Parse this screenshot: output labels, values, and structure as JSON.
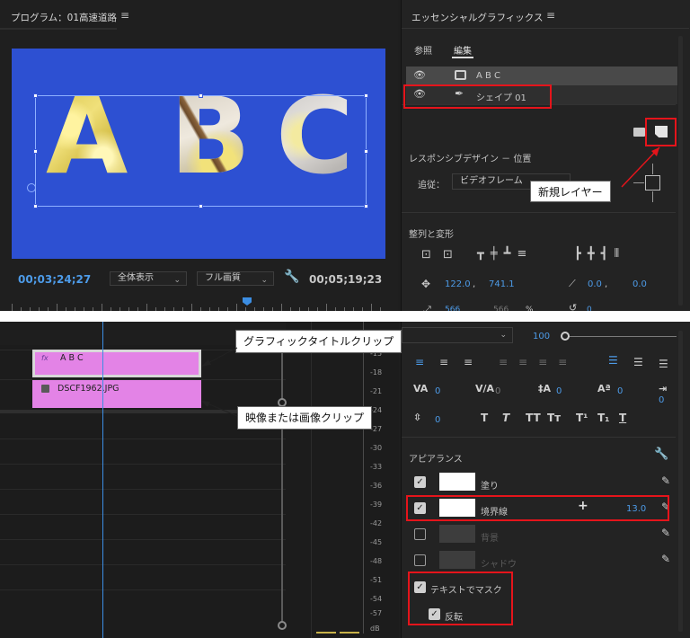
{
  "program": {
    "title": "プログラム：01高速道路",
    "letters": [
      "A",
      "B",
      "C"
    ],
    "timecode_current": "00;03;24;27",
    "zoom": "全体表示",
    "quality": "フル画質",
    "timecode_duration": "00;05;19;23"
  },
  "egfx": {
    "title": "エッセンシャルグラフィックス",
    "tab_browse": "参照",
    "tab_edit": "編集",
    "layers": [
      {
        "label": "A B C"
      },
      {
        "label": "シェイプ 01"
      }
    ],
    "responsive_title": "レスポンシブデザイン － 位置",
    "follow_label": "追従：",
    "follow_value": "ビデオフレーム",
    "align_title": "整列と変形",
    "pos_x": "122.0",
    "pos_sep": ",",
    "pos_y": "741.1",
    "anchor_x": "0.0",
    "anchor_sep": ",",
    "anchor_y": "0.0",
    "scale_w": "566",
    "scale_h": "566",
    "scale_pct": "%",
    "rotation": "0"
  },
  "callouts": {
    "new_layer": "新規レイヤー",
    "graphic_clip": "グラフィックタイトルクリップ",
    "media_clip": "映像または画像クリップ"
  },
  "timeline": {
    "clip_graphic": "A B C",
    "clip_media": "DSCF1962.JPG",
    "fx": "fx"
  },
  "meter": {
    "db_labels": [
      "-15",
      "-18",
      "-21",
      "-24",
      "-27",
      "-30",
      "-33",
      "-36",
      "-39",
      "-42",
      "-45",
      "-48",
      "-51",
      "-54",
      "-57",
      "dB"
    ]
  },
  "text_panel": {
    "opacity": "100",
    "tracking": "0",
    "kerning": "0",
    "leading": "0",
    "baseline": "0",
    "tsume": "0",
    "tab_width": "0",
    "style_buttons": [
      "T",
      "T",
      "TT",
      "Tт",
      "T¹",
      "T₁",
      "T"
    ],
    "appearance_title": "アピアランス",
    "fill_label": "塗り",
    "stroke_label": "境界線",
    "stroke_value": "13.0",
    "background_label": "背景",
    "shadow_label": "シャドウ",
    "mask_label": "テキストでマスク",
    "invert_label": "反転"
  },
  "colors": {
    "accent": "#4d9be8",
    "highlight": "#e5141b",
    "clip": "#e383e6",
    "video_bg": "#2d50d2"
  }
}
